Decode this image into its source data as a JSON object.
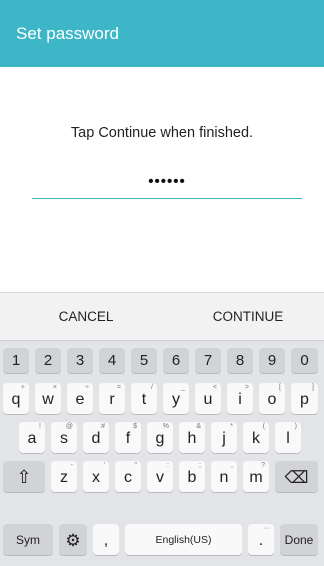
{
  "appbar": {
    "title": "Set password"
  },
  "content": {
    "prompt": "Tap Continue when finished.",
    "password_mask": "••••••"
  },
  "actions": {
    "cancel": "CANCEL",
    "continue": "CONTINUE"
  },
  "keyboard": {
    "numbers": [
      "1",
      "2",
      "3",
      "4",
      "5",
      "6",
      "7",
      "8",
      "9",
      "0"
    ],
    "row1": [
      "q",
      "w",
      "e",
      "r",
      "t",
      "y",
      "u",
      "i",
      "o",
      "p"
    ],
    "row1_sup": [
      "+",
      "×",
      "÷",
      "=",
      "/",
      "_",
      "<",
      ">",
      "[",
      "]"
    ],
    "row2": [
      "a",
      "s",
      "d",
      "f",
      "g",
      "h",
      "j",
      "k",
      "l"
    ],
    "row2_sup": [
      "!",
      "@",
      "#",
      "$",
      "%",
      "&",
      "*",
      "(",
      ")"
    ],
    "row3": [
      "z",
      "x",
      "c",
      "v",
      "b",
      "n",
      "m"
    ],
    "row3_sup": [
      "-",
      "'",
      "\"",
      ":",
      ";",
      ",",
      "?"
    ],
    "shift_icon": "⇧",
    "backspace_icon": "⌫",
    "sym_label": "Sym",
    "settings_icon": "⚙",
    "comma": ",",
    "space_label": "English(US)",
    "period": ".",
    "period_sup": "···",
    "done_label": "Done"
  },
  "colors": {
    "accent": "#3db7c8"
  }
}
